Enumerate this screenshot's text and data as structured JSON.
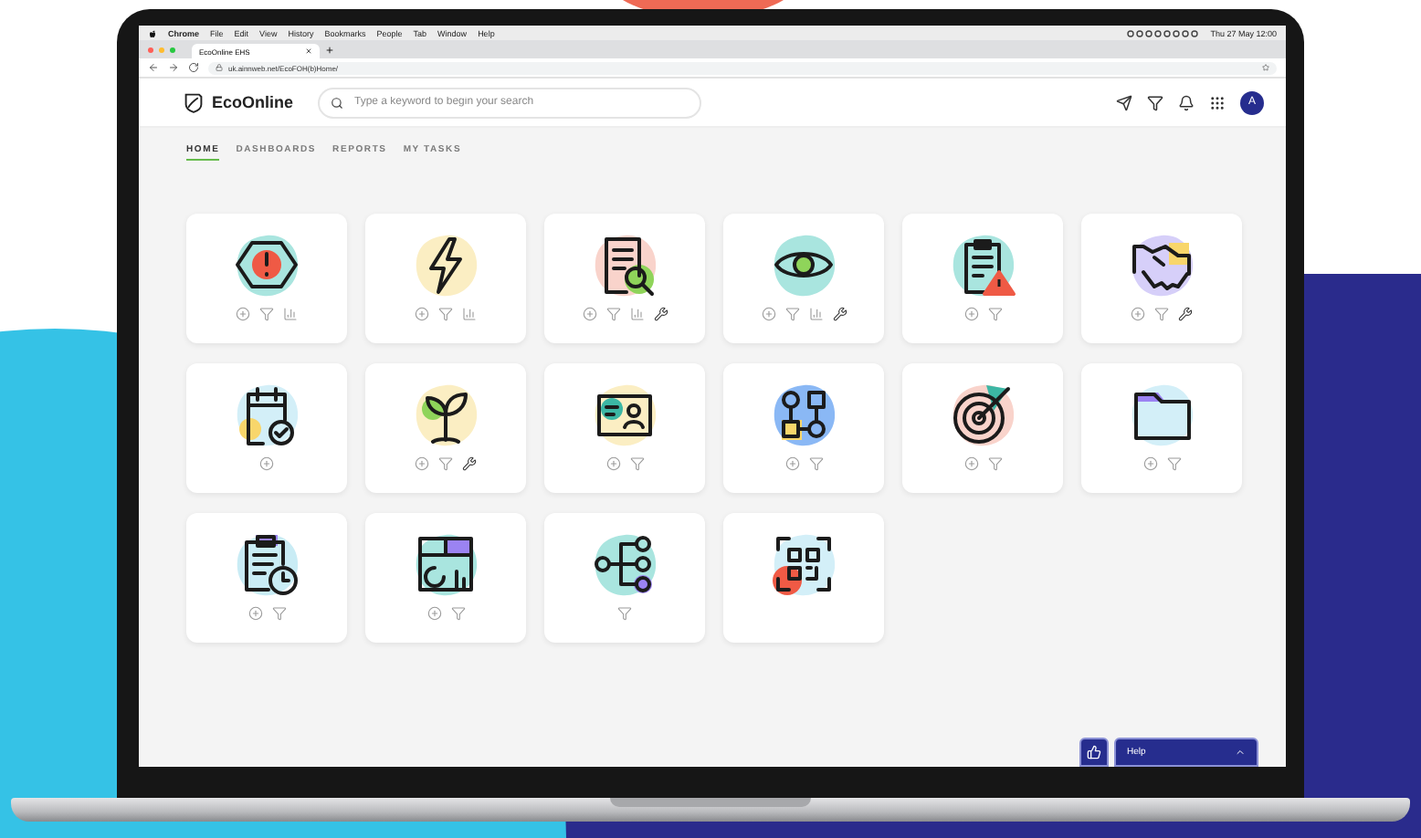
{
  "menu_bar": {
    "app": "Chrome",
    "items": [
      "File",
      "Edit",
      "View",
      "History",
      "Bookmarks",
      "People",
      "Tab",
      "Window",
      "Help"
    ],
    "clock": "Thu 27 May 12:00"
  },
  "browser": {
    "tab_title": "EcoOnline EHS",
    "url": "uk.ainnweb.net/EcoFOH(b)Home/"
  },
  "header": {
    "logo": "EcoOnline",
    "search": {
      "placeholder": "Type a keyword to begin your search"
    },
    "avatar": "A"
  },
  "nav": [
    {
      "label": "HOME",
      "selected": true
    },
    {
      "label": "DASHBOARDS",
      "selected": false
    },
    {
      "label": "REPORTS",
      "selected": false
    },
    {
      "label": "MY TASKS",
      "selected": false
    }
  ],
  "modules": [
    {
      "kind": "hexagon",
      "color": "#a9e5df",
      "actions": [
        {
          "kind": "add"
        },
        {
          "kind": "filter"
        },
        {
          "kind": "report"
        }
      ]
    },
    {
      "kind": "bolt",
      "color": "#fbeec3",
      "actions": [
        {
          "kind": "add"
        },
        {
          "kind": "filter"
        },
        {
          "kind": "report"
        }
      ]
    },
    {
      "kind": "document",
      "color": "#f9d3cb",
      "actions": [
        {
          "kind": "add"
        },
        {
          "kind": "filter"
        },
        {
          "kind": "report"
        },
        {
          "kind": "tools"
        }
      ]
    },
    {
      "kind": "eye",
      "color": "#a9e5df",
      "actions": [
        {
          "kind": "add"
        },
        {
          "kind": "filter"
        },
        {
          "kind": "report"
        },
        {
          "kind": "tools"
        }
      ]
    },
    {
      "kind": "clipboard",
      "color": "#a9e5df",
      "actions": [
        {
          "kind": "add"
        },
        {
          "kind": "filter"
        }
      ]
    },
    {
      "kind": "handshake",
      "color": "#d6cff9",
      "actions": [
        {
          "kind": "add"
        },
        {
          "kind": "filter"
        },
        {
          "kind": "tools"
        }
      ]
    },
    {
      "kind": "calendar",
      "color": "#d3eff8",
      "actions": [
        {
          "kind": "add"
        }
      ]
    },
    {
      "kind": "sprout",
      "color": "#fbeec3",
      "actions": [
        {
          "kind": "add"
        },
        {
          "kind": "filter"
        },
        {
          "kind": "tools"
        }
      ]
    },
    {
      "kind": "card",
      "color": "#fbeec3",
      "actions": [
        {
          "kind": "add"
        },
        {
          "kind": "filter"
        }
      ]
    },
    {
      "kind": "flow",
      "color": "#8ab8f5",
      "actions": [
        {
          "kind": "add"
        },
        {
          "kind": "filter"
        }
      ]
    },
    {
      "kind": "target",
      "color": "#f9d3cb",
      "actions": [
        {
          "kind": "add"
        },
        {
          "kind": "filter"
        }
      ]
    },
    {
      "kind": "folder",
      "color": "#d3eff8",
      "actions": [
        {
          "kind": "add"
        },
        {
          "kind": "filter"
        }
      ]
    },
    {
      "kind": "schedule",
      "color": "#c9ecf5",
      "actions": [
        {
          "kind": "add"
        },
        {
          "kind": "filter"
        }
      ]
    },
    {
      "kind": "dashboard",
      "color": "#a9e5df",
      "actions": [
        {
          "kind": "add"
        },
        {
          "kind": "filter"
        }
      ]
    },
    {
      "kind": "tree",
      "color": "#a9e5df",
      "actions": [
        {
          "kind": "filter"
        }
      ]
    },
    {
      "kind": "qr",
      "color": "#d3eff8"
    }
  ],
  "help": {
    "label": "Help"
  }
}
